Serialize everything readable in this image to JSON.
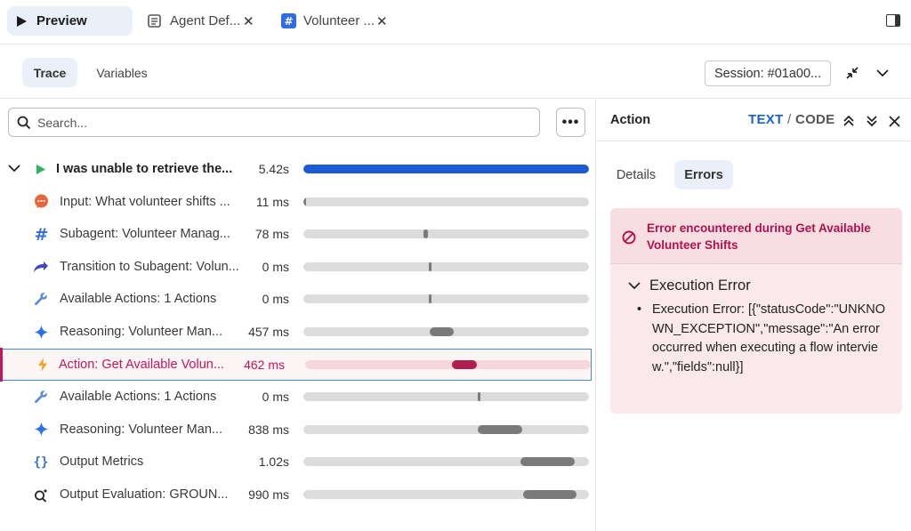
{
  "tabs": [
    {
      "label": "Preview",
      "icon": "play-icon",
      "active": true
    },
    {
      "label": "Agent Def...",
      "icon": "document-icon",
      "closable": true
    },
    {
      "label": "Volunteer ...",
      "icon": "hash-icon",
      "closable": true
    }
  ],
  "subtabs": [
    {
      "label": "Trace",
      "active": true
    },
    {
      "label": "Variables"
    }
  ],
  "session_label": "Session: #01a00...",
  "search_placeholder": "Search...",
  "more_label": "•••",
  "trace": [
    {
      "label": "I was unable to retrieve the...",
      "duration": "5.42s",
      "icon": "play-icon",
      "bar_start": 0.0,
      "bar_end": 1.0,
      "bar_color": "#1d5bd4"
    },
    {
      "label": "Input: What volunteer shifts ...",
      "duration": "11 ms",
      "icon": "chat-bubble-icon",
      "bar_start": 0.0,
      "bar_end": 0.01
    },
    {
      "label": "Subagent: Volunteer Manag...",
      "duration": "78 ms",
      "icon": "hash-icon",
      "bar_start": 0.42,
      "bar_end": 0.435
    },
    {
      "label": "Transition to Subagent: Volun...",
      "duration": "0 ms",
      "icon": "redirect-arrow-icon",
      "bar_start": 0.44,
      "bar_end": 0.446
    },
    {
      "label": "Available Actions: 1 Actions",
      "duration": "0 ms",
      "icon": "wrench-icon",
      "bar_start": 0.44,
      "bar_end": 0.446
    },
    {
      "label": "Reasoning: Volunteer Man...",
      "duration": "457 ms",
      "icon": "sparkle-icon",
      "bar_start": 0.443,
      "bar_end": 0.525
    },
    {
      "label": "Action: Get Available Volun...",
      "duration": "462 ms",
      "icon": "lightning-icon",
      "bar_start": 0.515,
      "bar_end": 0.6,
      "bar_color": "#b01e52",
      "selected": true
    },
    {
      "label": "Available Actions: 1 Actions",
      "duration": "0 ms",
      "icon": "wrench-icon",
      "bar_start": 0.61,
      "bar_end": 0.616
    },
    {
      "label": "Reasoning: Volunteer Man...",
      "duration": "838 ms",
      "icon": "sparkle-icon",
      "bar_start": 0.612,
      "bar_end": 0.765
    },
    {
      "label": "Output Metrics",
      "duration": "1.02s",
      "icon": "braces-icon",
      "bar_start": 0.76,
      "bar_end": 0.95
    },
    {
      "label": "Output Evaluation: GROUN...",
      "duration": "990 ms",
      "icon": "magnify-sparkle-icon",
      "bar_start": 0.77,
      "bar_end": 0.955
    }
  ],
  "detail": {
    "title": "Action",
    "view_text": "TEXT",
    "view_sep": "/",
    "view_code": "CODE",
    "tabs": [
      {
        "label": "Details"
      },
      {
        "label": "Errors",
        "active": true
      }
    ],
    "error_title": "Error encountered during Get Available Volunteer Shifts",
    "exec_heading": "Execution Error",
    "exec_text": "Execution Error: [{\"statusCode\":\"UNKNOWN_EXCEPTION\",\"message\":\"An error occurred when executing a flow interview.\",\"fields\":null}]"
  },
  "colors": {
    "accent": "#1b5fd6",
    "error": "#b0124d",
    "bar_default": "#7a7a7a",
    "track": "#dcdcdc"
  }
}
